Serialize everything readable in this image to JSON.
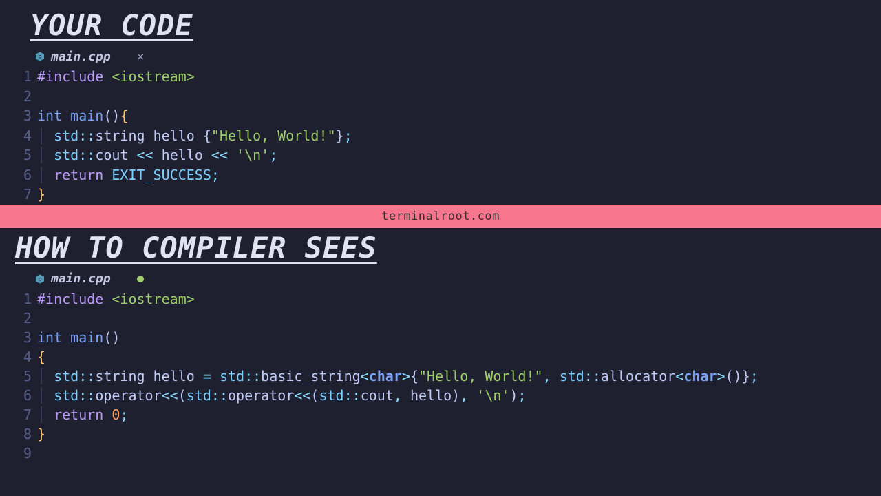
{
  "top": {
    "heading": "YOUR CODE",
    "filename": "main.cpp",
    "tab_close": "×",
    "lines": {
      "ln1": "1",
      "ln2": "2",
      "ln3": "3",
      "ln4": "4",
      "ln5": "5",
      "ln6": "6",
      "ln7": "7",
      "l1a": "#include",
      "l1b": " ",
      "l1c": "<iostream>",
      "l3a": "int",
      "l3b": " ",
      "l3c": "main",
      "l3d": "()",
      "l3e": "{",
      "l4g": "│ ",
      "l4a": "std",
      "l4b": "::",
      "l4c": "string",
      "l4d": " hello ",
      "l4e": "{",
      "l4f": "\"Hello, World!\"",
      "l4h": "}",
      "l4i": ";",
      "l5g": "│ ",
      "l5a": "std",
      "l5b": "::",
      "l5c": "cout",
      "l5d": " << ",
      "l5e": "hello",
      "l5f": " << ",
      "l5h": "'\\n'",
      "l5i": ";",
      "l6g": "│ ",
      "l6a": "return",
      "l6b": " ",
      "l6c": "EXIT_SUCCESS",
      "l6d": ";",
      "l7a": "}"
    }
  },
  "divider": "terminalroot.com",
  "bottom": {
    "heading": "HOW TO COMPILER SEES",
    "filename": "main.cpp",
    "lines": {
      "ln1": "1",
      "ln2": "2",
      "ln3": "3",
      "ln4": "4",
      "ln5": "5",
      "ln6": "6",
      "ln7": "7",
      "ln8": "8",
      "ln9": "9",
      "l1a": "#include",
      "l1b": " ",
      "l1c": "<iostream>",
      "l3a": "int",
      "l3b": " ",
      "l3c": "main",
      "l3d": "()",
      "l4a": "{",
      "l5g": "│ ",
      "l5a": "std",
      "l5b": "::",
      "l5c": "string",
      "l5d": " hello ",
      "l5e": "=",
      "l5f": " ",
      "l5h": "std",
      "l5i": "::",
      "l5j": "basic_string",
      "l5k": "<",
      "l5l": "char",
      "l5m": ">",
      "l5n": "{",
      "l5o": "\"Hello, World!\"",
      "l5p": ",",
      "l5q": " ",
      "l5r": "std",
      "l5s": "::",
      "l5t": "allocator",
      "l5u": "<",
      "l5v": "char",
      "l5w": ">",
      "l5x": "()}",
      "l5y": ";",
      "l6g": "│ ",
      "l6a": "std",
      "l6b": "::",
      "l6c": "operator",
      "l6d": "<<",
      "l6e": "(",
      "l6f": "std",
      "l6h": "::",
      "l6i": "operator",
      "l6j": "<<",
      "l6k": "(",
      "l6l": "std",
      "l6m": "::",
      "l6n": "cout",
      "l6o": ",",
      "l6p": " hello",
      "l6q": ")",
      "l6r": ",",
      "l6s": " ",
      "l6t": "'\\n'",
      "l6u": ")",
      "l6v": ";",
      "l7g": "│ ",
      "l7a": "return",
      "l7b": " ",
      "l7c": "0",
      "l7d": ";",
      "l8a": "}"
    }
  }
}
